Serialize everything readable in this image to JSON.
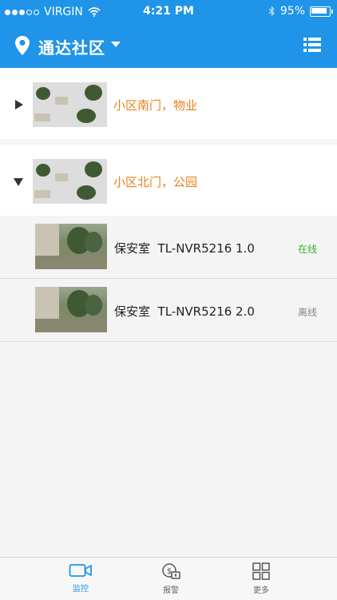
{
  "status_bar": {
    "carrier": "VIRGIN",
    "time": "4:21 PM",
    "battery": "95%"
  },
  "header": {
    "title": "通达社区"
  },
  "groups": [
    {
      "label": "小区南门，物业",
      "expanded": false
    },
    {
      "label": "小区北门，公园",
      "expanded": true
    }
  ],
  "devices": [
    {
      "name": "保安室  TL-NVR5216 1.0",
      "status": "在线",
      "status_color": "#33b233"
    },
    {
      "name": "保安室  TL-NVR5216 2.0",
      "status": "离线",
      "status_color": "#888888"
    }
  ],
  "tabs": [
    {
      "label": "监控",
      "icon": "camera-icon",
      "active": true
    },
    {
      "label": "报警",
      "icon": "alarm-icon",
      "active": false
    },
    {
      "label": "更多",
      "icon": "grid-icon",
      "active": false
    }
  ],
  "colors": {
    "accent": "#1f94e8",
    "group_label": "#e8811a"
  }
}
